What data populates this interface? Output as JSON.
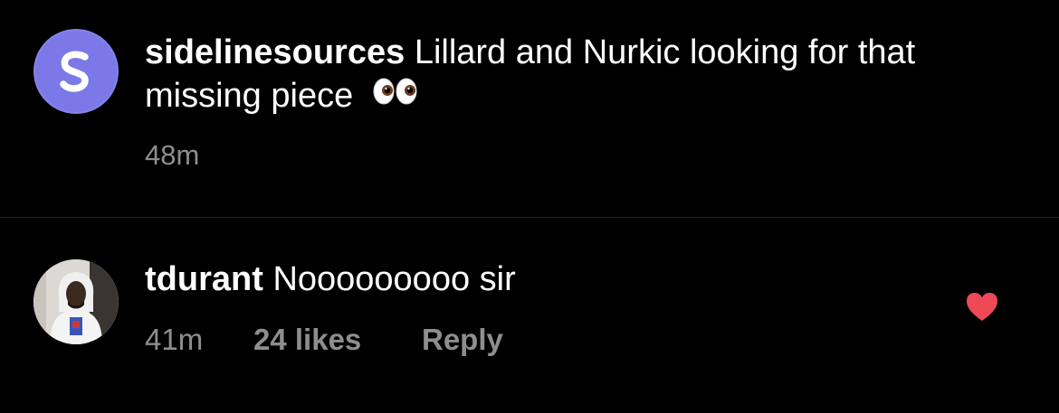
{
  "caption": {
    "avatar_letter": "S",
    "username": "sidelinesources",
    "text": "Lillard and Nurkic looking for that missing piece",
    "emoji": "👀",
    "time": "48m"
  },
  "comment": {
    "username": "tdurant",
    "text": "Nooooooooo sir",
    "time": "41m",
    "likes": "24 likes",
    "reply_label": "Reply",
    "liked": true
  },
  "colors": {
    "background": "#000000",
    "text": "#ffffff",
    "secondary_text": "#8e8e8e",
    "divider": "#262626",
    "avatar_purple": "#7b79e8",
    "heart_red": "#ed4956"
  },
  "icons": {
    "caption_avatar": "sidelinesources-logo-icon",
    "comment_avatar": "tdurant-profile-photo",
    "like": "heart-filled-icon",
    "emoji": "eyes-icon"
  }
}
